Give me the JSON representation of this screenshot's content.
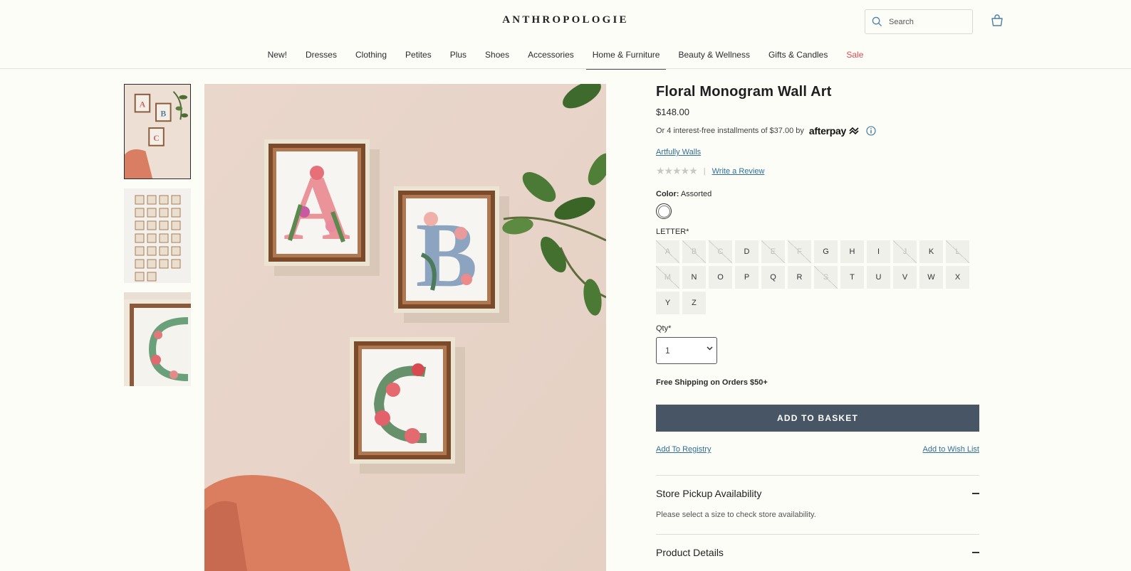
{
  "header": {
    "logo": "ANTHROPOLOGIE",
    "search_placeholder": "Search"
  },
  "nav": {
    "items": [
      "New!",
      "Dresses",
      "Clothing",
      "Petites",
      "Plus",
      "Shoes",
      "Accessories",
      "Home & Furniture",
      "Beauty & Wellness",
      "Gifts & Candles",
      "Sale"
    ],
    "active_index": 7,
    "sale_index": 10
  },
  "product": {
    "title": "Floral Monogram Wall Art",
    "price": "$148.00",
    "installments_text": "Or 4 interest-free installments of $37.00 by",
    "afterpay_label": "afterpay",
    "brand": "Artfully Walls",
    "stars": "★★★★★",
    "rating_separator": "|",
    "write_review": "Write a Review",
    "color_label": "Color:",
    "color_value": "Assorted",
    "letter_label": "LETTER*",
    "letters": [
      {
        "l": "A",
        "available": false
      },
      {
        "l": "B",
        "available": false
      },
      {
        "l": "C",
        "available": false
      },
      {
        "l": "D",
        "available": true
      },
      {
        "l": "E",
        "available": false
      },
      {
        "l": "F",
        "available": false
      },
      {
        "l": "G",
        "available": true
      },
      {
        "l": "H",
        "available": true
      },
      {
        "l": "I",
        "available": true
      },
      {
        "l": "J",
        "available": false
      },
      {
        "l": "K",
        "available": true
      },
      {
        "l": "L",
        "available": false
      },
      {
        "l": "M",
        "available": false
      },
      {
        "l": "N",
        "available": true
      },
      {
        "l": "O",
        "available": true
      },
      {
        "l": "P",
        "available": true
      },
      {
        "l": "Q",
        "available": true
      },
      {
        "l": "R",
        "available": true
      },
      {
        "l": "S",
        "available": false
      },
      {
        "l": "T",
        "available": true
      },
      {
        "l": "U",
        "available": true
      },
      {
        "l": "V",
        "available": true
      },
      {
        "l": "W",
        "available": true
      },
      {
        "l": "X",
        "available": true
      },
      {
        "l": "Y",
        "available": true
      },
      {
        "l": "Z",
        "available": true
      }
    ],
    "qty_label": "Qty*",
    "qty_value": "1",
    "shipping": "Free Shipping on Orders $50+",
    "add_to_basket": "ADD TO BASKET",
    "add_to_registry": "Add To Registry",
    "add_to_wishlist": "Add to Wish List"
  },
  "accordions": {
    "store_pickup_title": "Store Pickup Availability",
    "store_pickup_body": "Please select a size to check store availability.",
    "product_details_title": "Product Details"
  },
  "colors": {
    "background": "#fdfdf8",
    "button": "#475565",
    "link": "#2f6f9a",
    "sale": "#e04a52"
  }
}
